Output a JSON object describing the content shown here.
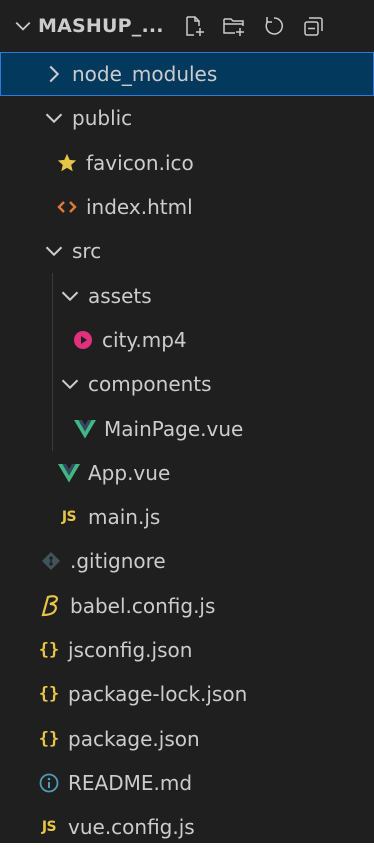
{
  "header": {
    "title": "MASHUP_...",
    "actions": [
      "new-file",
      "new-folder",
      "refresh",
      "collapse-all"
    ]
  },
  "tree": {
    "node_modules": "node_modules",
    "public": "public",
    "favicon": "favicon.ico",
    "index_html": "index.html",
    "src": "src",
    "assets": "assets",
    "city": "city.mp4",
    "components": "components",
    "mainpage": "MainPage.vue",
    "app": "App.vue",
    "mainjs": "main.js",
    "gitignore": ".gitignore",
    "babel": "babel.config.js",
    "jsconfig": "jsconfig.json",
    "packagelock": "package-lock.json",
    "package": "package.json",
    "readme": "README.md",
    "vueconfig": "vue.config.js"
  },
  "badges": {
    "js": "JS",
    "json": "{}"
  },
  "colors": {
    "background": "#1f1f1f",
    "text": "#cccccc",
    "selected": "#04395e",
    "vue": "#41b883",
    "js": "#e7c547",
    "html": "#e37933",
    "video": "#e0317d",
    "info": "#519aba"
  }
}
